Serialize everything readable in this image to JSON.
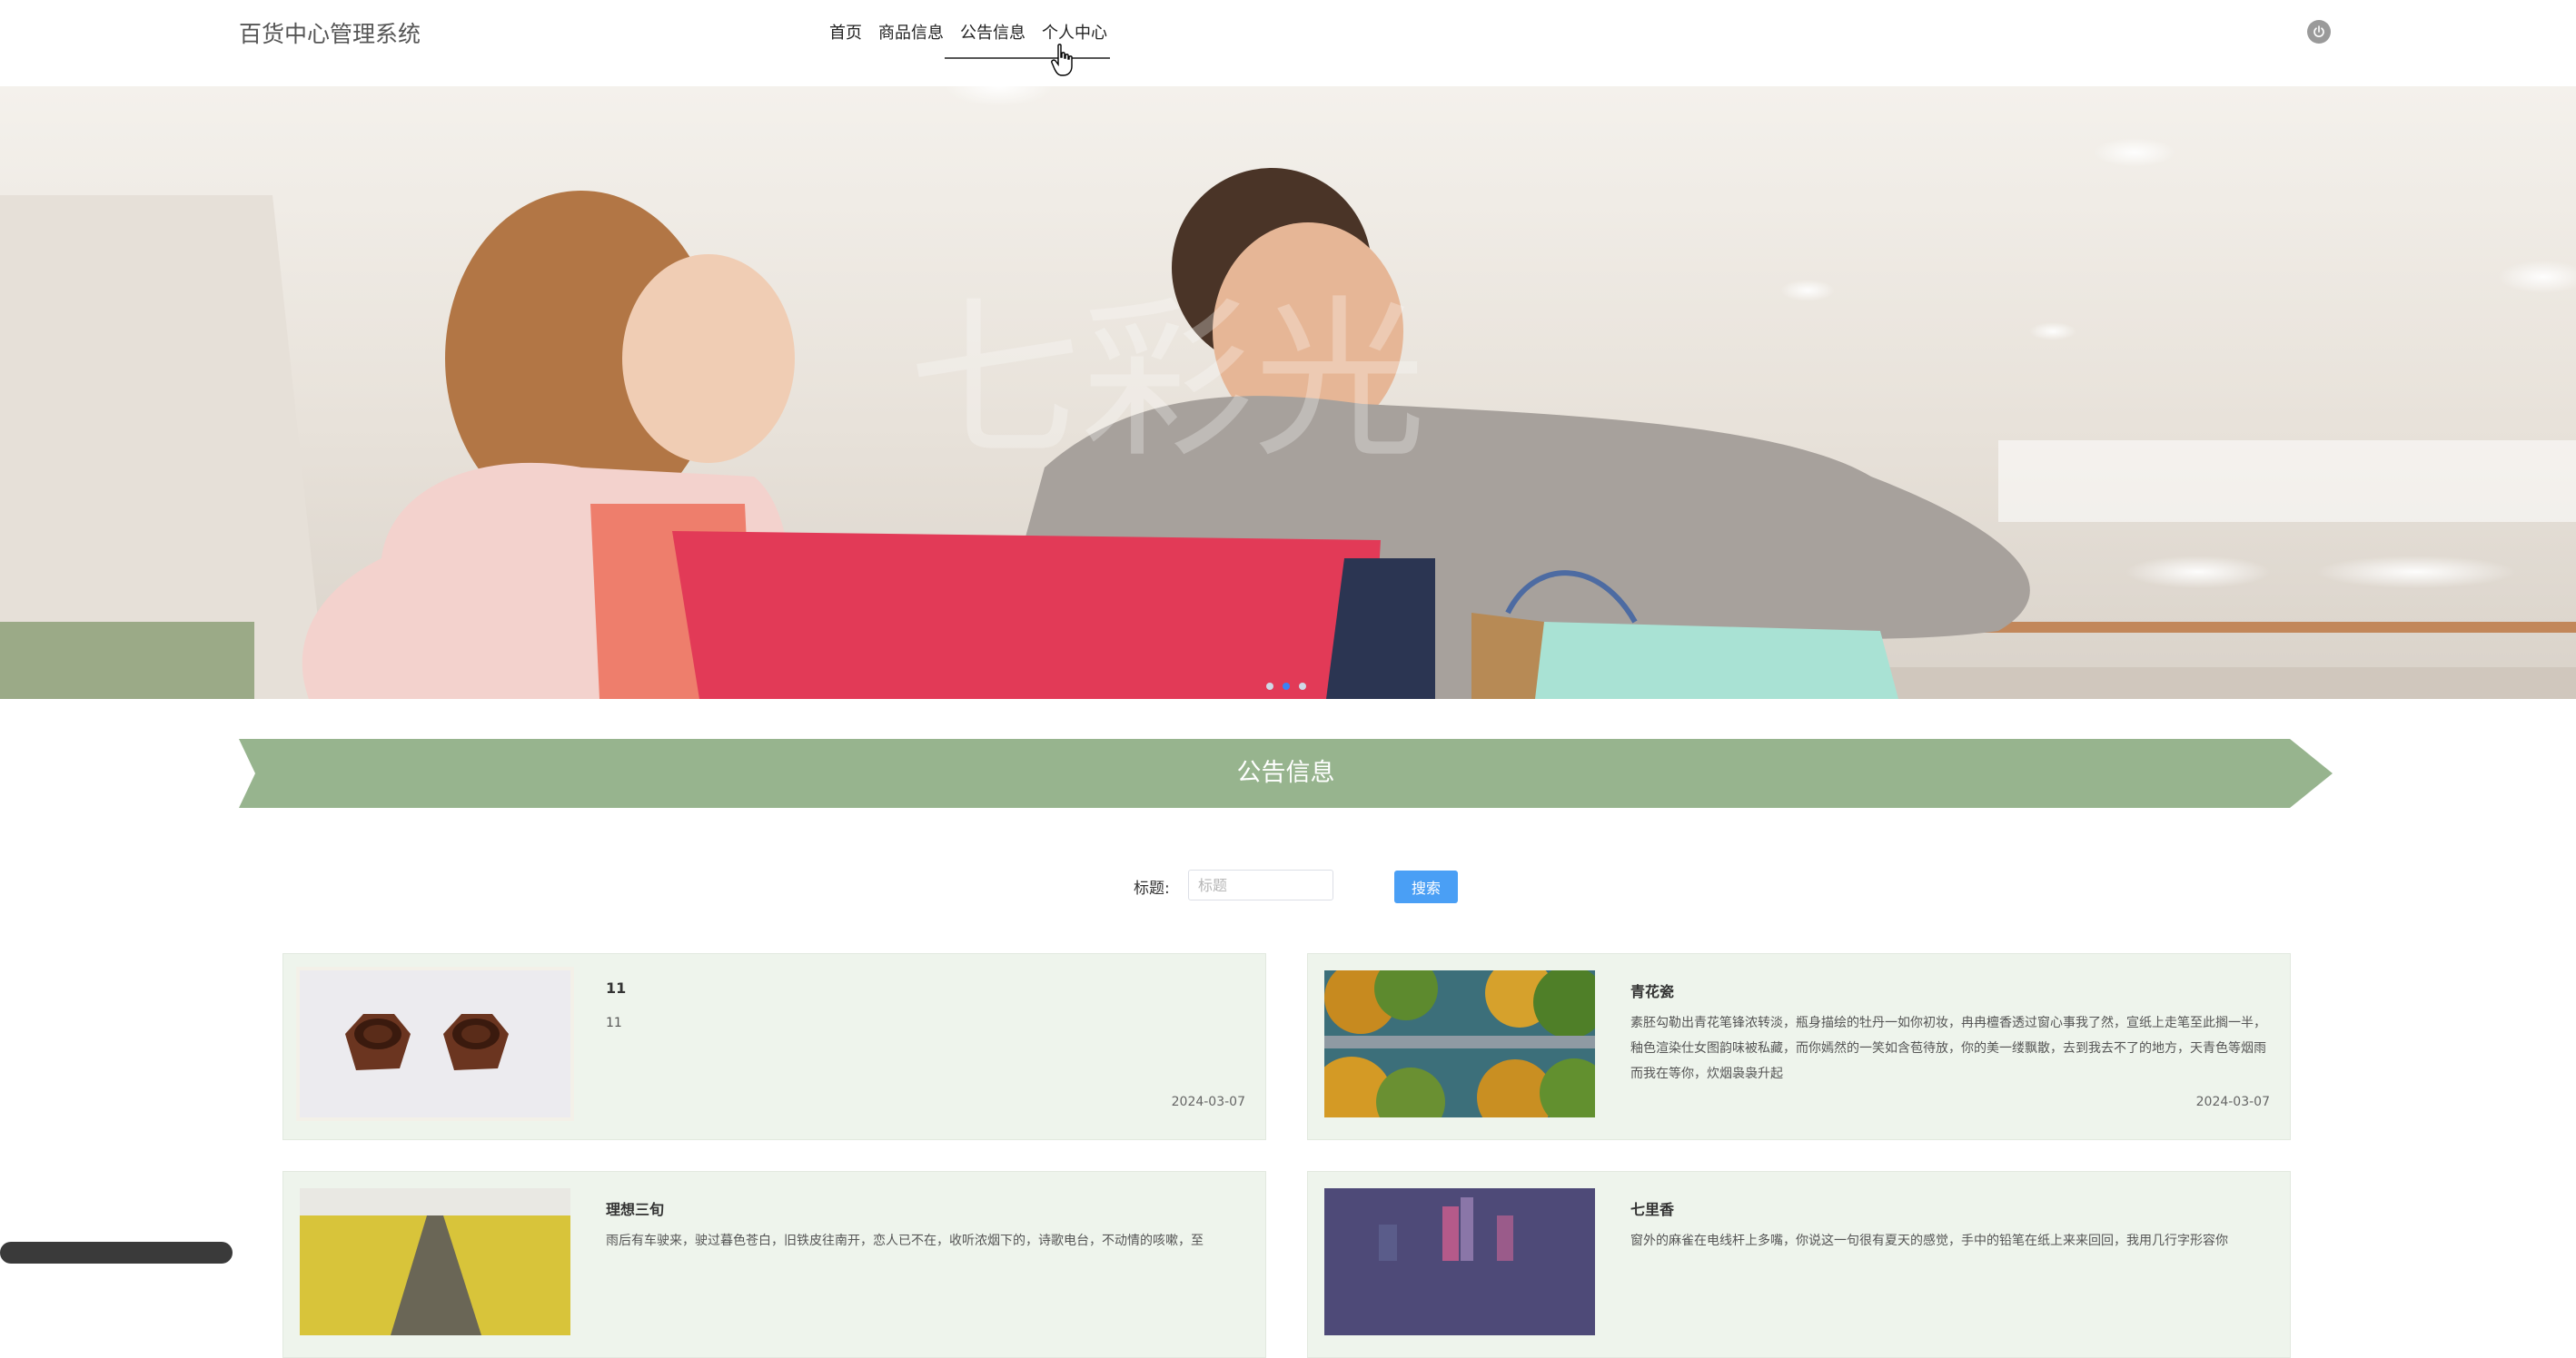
{
  "header": {
    "logo": "百货中心管理系统",
    "nav": [
      "首页",
      "商品信息",
      "公告信息",
      "个人中心"
    ]
  },
  "banner": {
    "watermark": "七彩光"
  },
  "section": {
    "title": "公告信息"
  },
  "search": {
    "label": "标题:",
    "placeholder": "标题",
    "button": "搜索"
  },
  "cards": [
    {
      "title": "11",
      "desc": "11",
      "date": "2024-03-07"
    },
    {
      "title": "青花瓷",
      "desc": "素胚勾勒出青花笔锋浓转淡，瓶身描绘的牡丹一如你初妆，冉冉檀香透过窗心事我了然，宣纸上走笔至此搁一半，釉色渲染仕女图韵味被私藏，而你嫣然的一笑如含苞待放，你的美一缕飘散，去到我去不了的地方，天青色等烟雨 而我在等你，炊烟袅袅升起",
      "date": "2024-03-07"
    },
    {
      "title": "理想三旬",
      "desc": "雨后有车驶来，驶过暮色苍白，旧铁皮往南开，恋人已不在，收听浓烟下的，诗歌电台，不动情的咳嗽，至",
      "date": ""
    },
    {
      "title": "七里香",
      "desc": "窗外的麻雀在电线杆上多嘴，你说这一句很有夏天的感觉，手中的铅笔在纸上来来回回，我用几行字形容你",
      "date": ""
    }
  ],
  "colors": {
    "accent": "#4a9ff5",
    "section_banner": "#97b48e",
    "card_bg": "#eef4ec"
  }
}
